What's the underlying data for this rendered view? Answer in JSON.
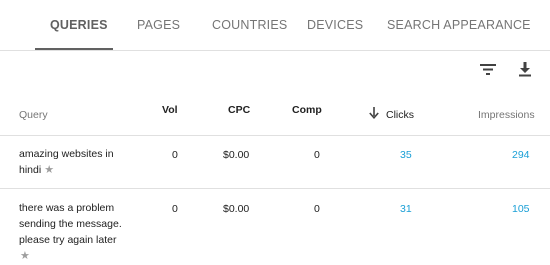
{
  "tabs": [
    {
      "label": "QUERIES",
      "active": true
    },
    {
      "label": "PAGES"
    },
    {
      "label": "COUNTRIES"
    },
    {
      "label": "DEVICES"
    },
    {
      "label": "SEARCH APPEARANCE"
    }
  ],
  "toolbar": {
    "filter_icon": "filter-list-icon",
    "download_icon": "download-icon"
  },
  "table": {
    "headers": {
      "query": "Query",
      "vol": "Vol",
      "cpc": "CPC",
      "comp": "Comp",
      "clicks": "Clicks",
      "impressions": "Impressions"
    },
    "sort_icon": "arrow-down-icon",
    "rows": [
      {
        "query_lines": [
          "amazing websites in",
          "hindi"
        ],
        "vol": "0",
        "cpc": "$0.00",
        "comp": "0",
        "clicks": "35",
        "impressions": "294"
      },
      {
        "query_lines": [
          "there was a problem",
          "sending the message.",
          "please try again later"
        ],
        "vol": "0",
        "cpc": "$0.00",
        "comp": "0",
        "clicks": "31",
        "impressions": "105"
      }
    ]
  },
  "colors": {
    "link": "#1a9fd6",
    "active_tab": "#616161",
    "divider": "#e0e0e0"
  }
}
